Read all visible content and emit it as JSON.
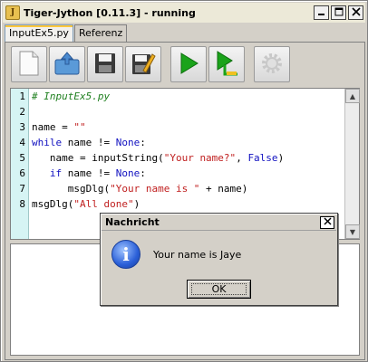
{
  "window": {
    "title": "Tiger-Jython [0.11.3] - running",
    "controls": [
      "minimize-icon",
      "maximize-icon",
      "close-icon"
    ]
  },
  "tabs": [
    {
      "label": "InputEx5.py",
      "active": true
    },
    {
      "label": "Referenz",
      "active": false
    }
  ],
  "toolbar": {
    "buttons": [
      {
        "icon": "new-file-icon",
        "enabled": true
      },
      {
        "icon": "open-file-icon",
        "enabled": true
      },
      {
        "icon": "save-icon",
        "enabled": true
      },
      {
        "icon": "save-as-icon",
        "enabled": true
      },
      {
        "icon": "run-icon",
        "enabled": true
      },
      {
        "icon": "debug-icon",
        "enabled": true
      },
      {
        "icon": "settings-icon",
        "enabled": false
      }
    ]
  },
  "editor": {
    "line_numbers": [
      "1",
      "2",
      "3",
      "4",
      "5",
      "6",
      "7",
      "8"
    ],
    "lines": [
      "# InputEx5.py",
      "",
      "name = \"\"",
      "while name != None:",
      "   name = inputString(\"Your name?\", False)",
      "   if name != None:",
      "      msgDlg(\"Your name is \" + name)",
      "msgDlg(\"All done\")"
    ]
  },
  "dialog": {
    "title": "Nachricht",
    "message": "Your name is Jaye",
    "ok_label": "OK",
    "icon": "info-icon"
  },
  "colors": {
    "keyword": "#1010c0",
    "string": "#c02020",
    "comment": "#208020",
    "gutter": "#d6f4f4",
    "run_green": "#1aa31a"
  }
}
